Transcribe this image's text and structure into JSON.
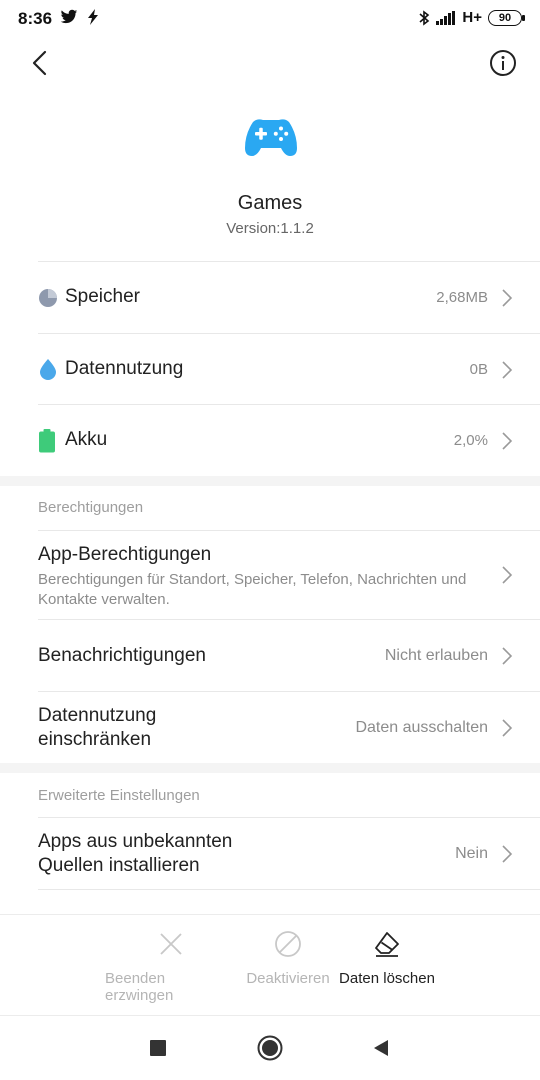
{
  "status_bar": {
    "time": "8:36",
    "network": "H+",
    "battery": "90"
  },
  "app": {
    "name": "Games",
    "version": "Version:1.1.2",
    "icon": "gamepad-icon",
    "icon_color": "#2aa8f2"
  },
  "usage": [
    {
      "label": "Speicher",
      "value": "2,68MB",
      "icon": "storage-pie-icon",
      "color": "#8e99ad"
    },
    {
      "label": "Datennutzung",
      "value": "0B",
      "icon": "data-drop-icon",
      "color": "#4aa8ea"
    },
    {
      "label": "Akku",
      "value": "2,0%",
      "icon": "battery-icon",
      "color": "#3ecb7a"
    }
  ],
  "permissions": {
    "header": "Berechtigungen",
    "app_permissions": {
      "title": "App-Berechtigungen",
      "subtitle": "Berechtigungen für Standort, Speicher, Telefon, Nachrichten und Kontakte verwalten."
    },
    "notifications": {
      "title": "Benachrichtigungen",
      "value": "Nicht erlauben"
    },
    "restrict_data": {
      "title_line1": "Datennutzung",
      "title_line2": "einschränken",
      "value": "Daten ausschalten"
    }
  },
  "advanced": {
    "header": "Erweiterte Einstellungen",
    "unknown_sources": {
      "title_line1": "Apps aus unbekannten",
      "title_line2": "Quellen installieren",
      "value": "Nein"
    }
  },
  "actions": {
    "force_stop": "Beenden erzwingen",
    "disable": "Deaktivieren",
    "clear_data": "Daten löschen"
  }
}
